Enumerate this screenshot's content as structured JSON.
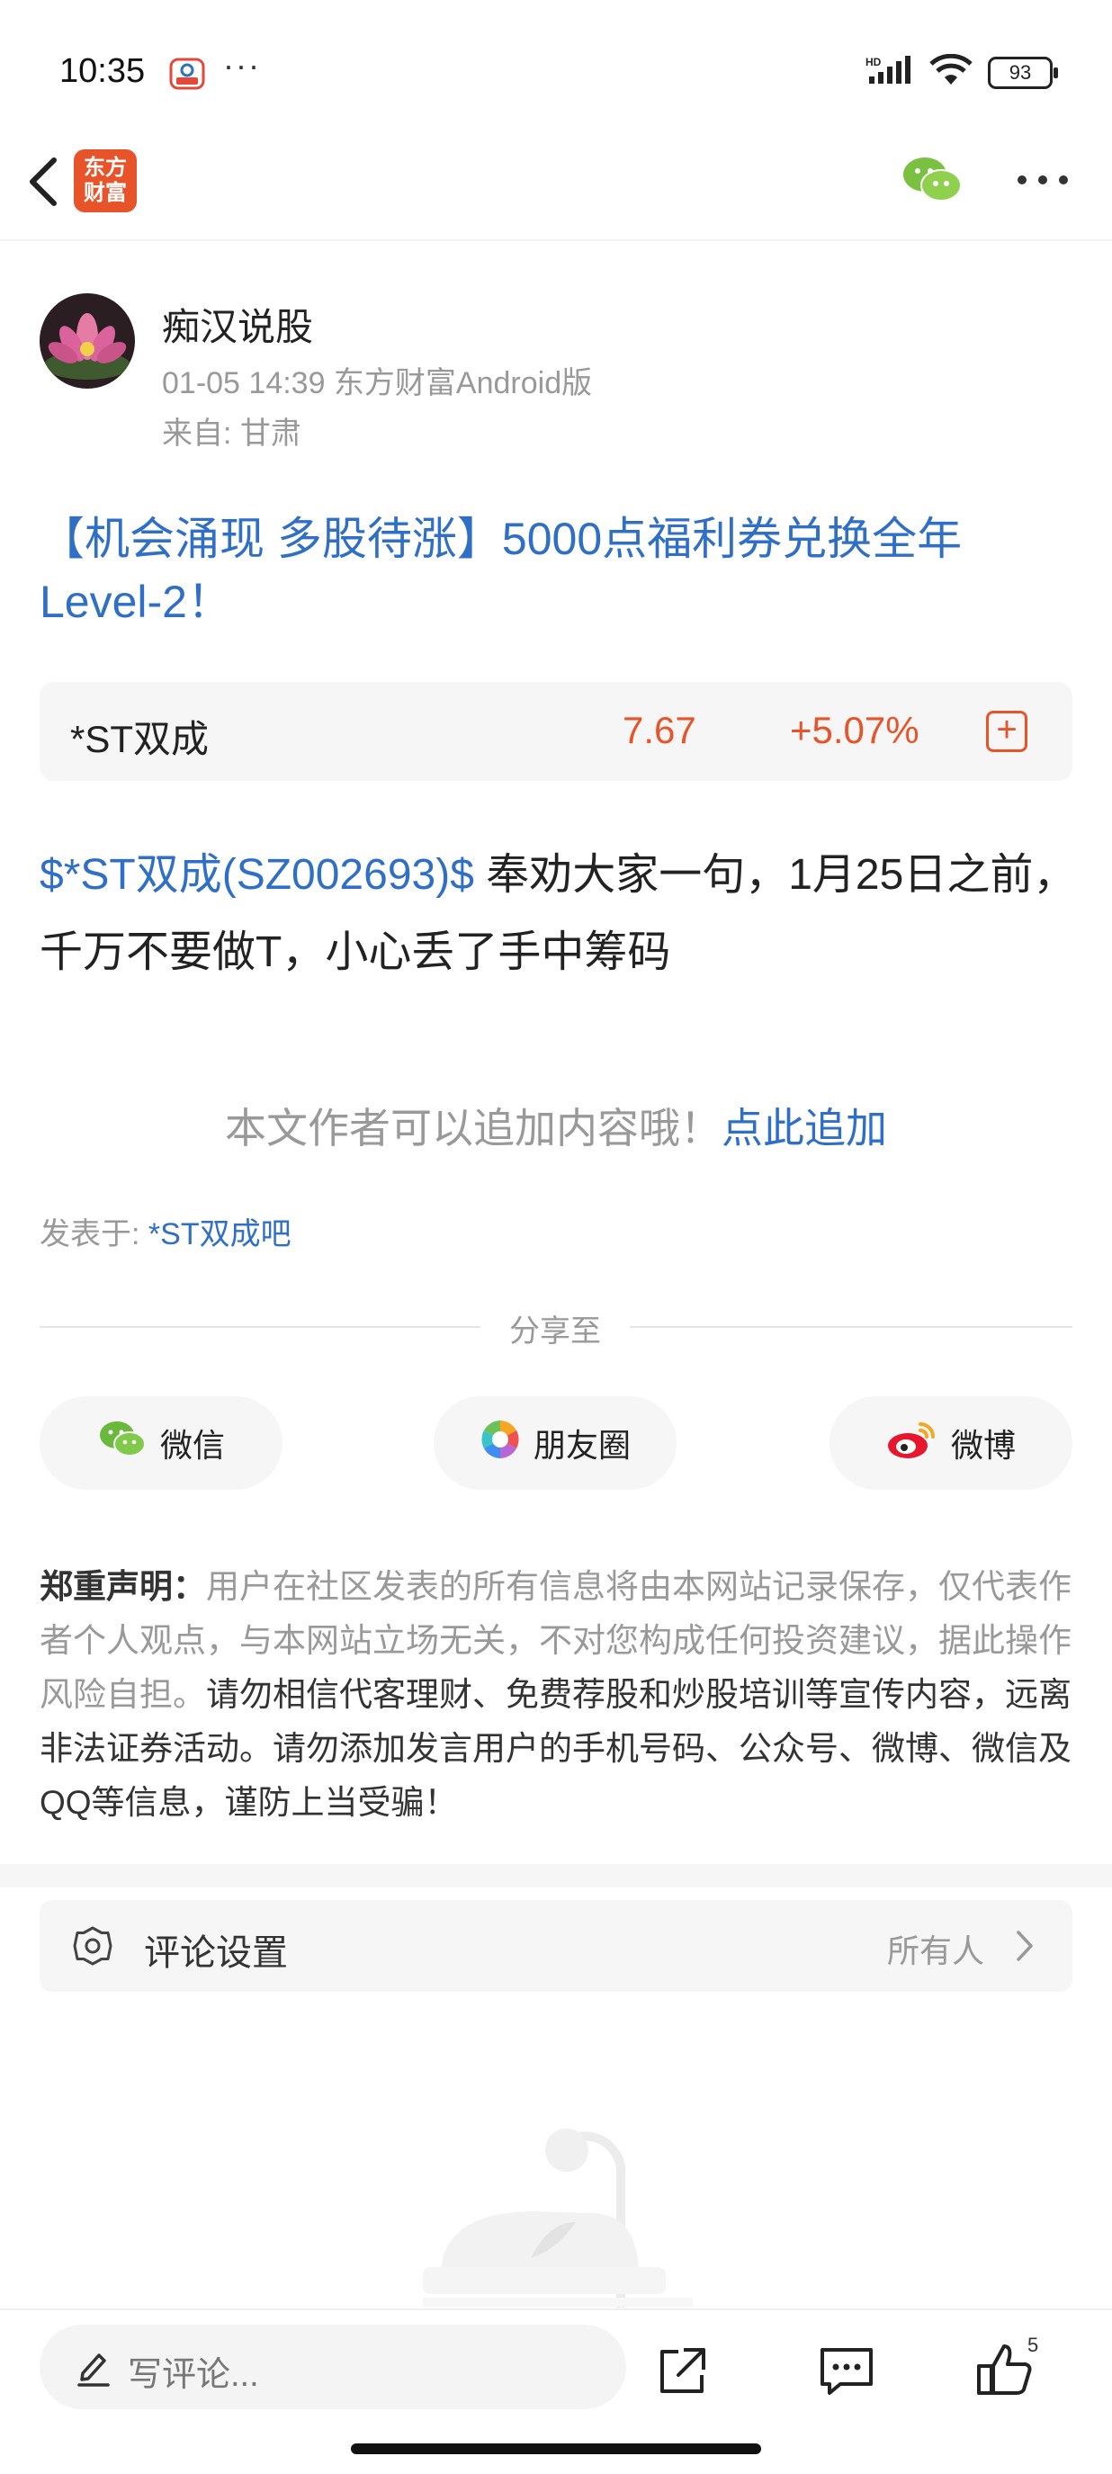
{
  "status_bar": {
    "time": "10:35",
    "dots": "···",
    "battery": "93",
    "network": "HD"
  },
  "nav": {
    "logo_line1": "东方",
    "logo_line2": "财富"
  },
  "author": {
    "name": "痴汉说股",
    "meta": "01-05 14:39 东方财富Android版",
    "origin": "来自: 甘肃"
  },
  "post": {
    "title": "【机会涌现 多股待涨】5000点福利券兑换全年Level-2！",
    "stock_tag": "$*ST双成(SZ002693)$",
    "body_text": " 奉劝大家一句，1月25日之前，千万不要做T，小心丢了手中筹码"
  },
  "stock_card": {
    "name": "*ST双成",
    "price": "7.67",
    "change": "+5.07%",
    "add_symbol": "+"
  },
  "append": {
    "prompt": "本文作者可以追加内容哦！",
    "link": "点此追加"
  },
  "published_in": {
    "label": "发表于: ",
    "bar": "*ST双成吧"
  },
  "share": {
    "label": "分享至",
    "buttons": [
      {
        "label": "微信",
        "icon": "wechat-icon"
      },
      {
        "label": "朋友圈",
        "icon": "moments-icon"
      },
      {
        "label": "微博",
        "icon": "weibo-icon"
      }
    ]
  },
  "disclaimer": {
    "heading": "郑重声明：",
    "text1": "用户在社区发表的所有信息将由本网站记录保存，仅代表作者个人观点，与本网站立场无关，不对您构成任何投资建议，据此操作风险自担。",
    "text2": "请勿相信代客理财、免费荐股和炒股培训等宣传内容，远离非法证券活动。请勿添加发言用户的手机号码、公众号、微博、微信及QQ等信息，谨防上当受骗！"
  },
  "comment_settings": {
    "label": "评论设置",
    "value": "所有人"
  },
  "bottom_bar": {
    "comment_placeholder": "写评论...",
    "like_count": "5"
  },
  "colors": {
    "accent_blue": "#2f6fc5",
    "stock_up": "#e8542a",
    "muted_text": "#999999",
    "card_bg": "#f6f6f7"
  }
}
